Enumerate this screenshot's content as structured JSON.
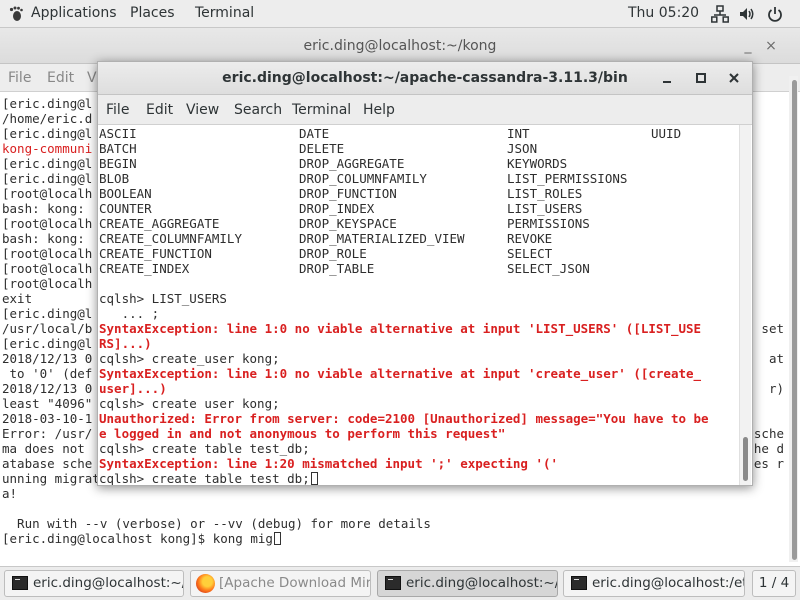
{
  "top_panel": {
    "applications": "Applications",
    "places": "Places",
    "terminal": "Terminal",
    "clock": "Thu 05:20",
    "icons": [
      "network-icon",
      "volume-icon",
      "power-icon"
    ]
  },
  "back_window": {
    "title": "eric.ding@localhost:~/kong",
    "menu": [
      "File",
      "Edit",
      "V"
    ],
    "lines": [
      {
        "text": "[eric.ding@l",
        "color": "dark"
      },
      {
        "text": "/home/eric.d",
        "color": "dark"
      },
      {
        "text": "[eric.ding@l",
        "color": "dark"
      },
      {
        "text": "kong-communi",
        "color": "red"
      },
      {
        "text": "[eric.ding@l",
        "color": "dark"
      },
      {
        "text": "[eric.ding@l",
        "color": "dark"
      },
      {
        "text": "[root@localh",
        "color": "dark"
      },
      {
        "text": "bash: kong:",
        "color": "dark"
      },
      {
        "text": "[root@localh",
        "color": "dark"
      },
      {
        "text": "bash: kong:",
        "color": "dark"
      },
      {
        "text": "[root@localh",
        "color": "dark"
      },
      {
        "text": "[root@localh",
        "color": "dark"
      },
      {
        "text": "[root@localh",
        "color": "dark"
      },
      {
        "text": "exit",
        "color": "dark"
      },
      {
        "text": "[eric.ding@l",
        "color": "dark"
      },
      {
        "text": "/usr/local/b",
        "color": "dark"
      },
      {
        "text": "[eric.ding@l",
        "color": "dark"
      },
      {
        "text": "2018/12/13 0",
        "color": "dark"
      },
      {
        "text": " to '0' (def",
        "color": "dark"
      },
      {
        "text": "2018/12/13 0",
        "color": "dark"
      },
      {
        "text": "least \"4096\"",
        "color": "dark"
      },
      {
        "text": "2018-03-10-1",
        "color": "dark"
      },
      {
        "text": "Error: /usr/",
        "color": "dark"
      },
      {
        "text": "ma does not",
        "color": "dark"
      },
      {
        "text": "atabase sche",
        "color": "dark"
      },
      {
        "text": "unning migrations concurrently will conflict with each other and might corrupt your database schem",
        "color": "dark"
      },
      {
        "text": "a!",
        "color": "dark"
      },
      {
        "text": "",
        "color": "dark"
      },
      {
        "text": "  Run with --v (verbose) or --vv (debug) for more details",
        "color": "dark"
      },
      {
        "text": "[eric.ding@localhost kong]$ kong mig",
        "color": "dark"
      }
    ],
    "right_fragments": [
      {
        "text": "set",
        "line": 15
      },
      {
        "text": "at",
        "line": 17
      },
      {
        "text": "r)",
        "line": 19
      },
      {
        "text": "sche",
        "line": 22
      },
      {
        "text": "he d",
        "line": 23
      },
      {
        "text": "es r",
        "line": 24
      }
    ]
  },
  "front_window": {
    "title": "eric.ding@localhost:~/apache-cassandra-3.11.3/bin",
    "menu": [
      "File",
      "Edit",
      "View",
      "Search",
      "Terminal",
      "Help"
    ],
    "keywords": [
      [
        "ASCII",
        "DATE",
        "INT",
        "UUID"
      ],
      [
        "BATCH",
        "DELETE",
        "JSON",
        ""
      ],
      [
        "BEGIN",
        "DROP_AGGREGATE",
        "KEYWORDS",
        ""
      ],
      [
        "BLOB",
        "DROP_COLUMNFAMILY",
        "LIST_PERMISSIONS",
        ""
      ],
      [
        "BOOLEAN",
        "DROP_FUNCTION",
        "LIST_ROLES",
        ""
      ],
      [
        "COUNTER",
        "DROP_INDEX",
        "LIST_USERS",
        ""
      ],
      [
        "CREATE_AGGREGATE",
        "DROP_KEYSPACE",
        "PERMISSIONS",
        ""
      ],
      [
        "CREATE_COLUMNFAMILY",
        "DROP_MATERIALIZED_VIEW",
        "REVOKE",
        ""
      ],
      [
        "CREATE_FUNCTION",
        "DROP_ROLE",
        "SELECT",
        ""
      ],
      [
        "CREATE_INDEX",
        "DROP_TABLE",
        "SELECT_JSON",
        ""
      ]
    ],
    "session": [
      {
        "text": "",
        "type": "normal"
      },
      {
        "text": "cqlsh> LIST_USERS",
        "type": "normal"
      },
      {
        "text": "   ... ;",
        "type": "normal"
      },
      {
        "text": "SyntaxException: line 1:0 no viable alternative at input 'LIST_USERS' ([LIST_USE",
        "type": "error"
      },
      {
        "text": "RS]...)",
        "type": "error"
      },
      {
        "text": "cqlsh> create_user kong;",
        "type": "normal"
      },
      {
        "text": "SyntaxException: line 1:0 no viable alternative at input 'create_user' ([create_",
        "type": "error"
      },
      {
        "text": "user]...)",
        "type": "error"
      },
      {
        "text": "cqlsh> create user kong;",
        "type": "normal"
      },
      {
        "text": "Unauthorized: Error from server: code=2100 [Unauthorized] message=\"You have to be",
        "type": "error"
      },
      {
        "text": "e logged in and not anonymous to perform this request\"",
        "type": "error"
      },
      {
        "text": "cqlsh> create table test_db;",
        "type": "normal"
      },
      {
        "text": "SyntaxException: line 1:20 mismatched input ';' expecting '('",
        "type": "error"
      },
      {
        "text": "cqlsh> create table test_db;",
        "type": "cursor"
      }
    ]
  },
  "taskbar": {
    "tasks": [
      {
        "label": "eric.ding@localhost:~/...",
        "icon": "terminal-icon",
        "state": "normal"
      },
      {
        "label": "[Apache Download Mir...",
        "icon": "firefox-icon",
        "state": "dim"
      },
      {
        "label": "eric.ding@localhost:~/...",
        "icon": "terminal-icon",
        "state": "active"
      },
      {
        "label": "eric.ding@localhost:/et...",
        "icon": "terminal-icon",
        "state": "normal"
      }
    ],
    "workspace": "1 / 4"
  }
}
